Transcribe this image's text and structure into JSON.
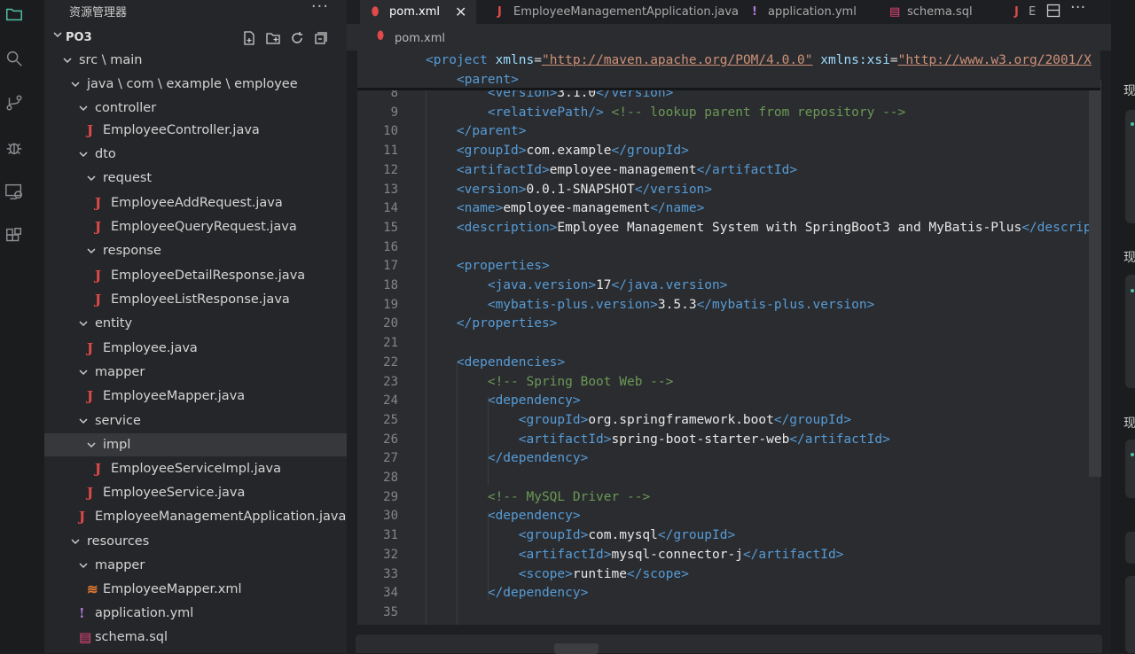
{
  "sidebar": {
    "title": "资源管理器",
    "more": "···",
    "project": "PO3",
    "tree": [
      {
        "label": "src \\ main",
        "type": "folder"
      },
      {
        "label": "java \\ com \\ example \\ employee",
        "type": "folder"
      },
      {
        "label": "controller",
        "type": "folder"
      },
      {
        "label": "EmployeeController.java",
        "type": "java"
      },
      {
        "label": "dto",
        "type": "folder"
      },
      {
        "label": "request",
        "type": "folder"
      },
      {
        "label": "EmployeeAddRequest.java",
        "type": "java"
      },
      {
        "label": "EmployeeQueryRequest.java",
        "type": "java"
      },
      {
        "label": "response",
        "type": "folder"
      },
      {
        "label": "EmployeeDetailResponse.java",
        "type": "java"
      },
      {
        "label": "EmployeeListResponse.java",
        "type": "java"
      },
      {
        "label": "entity",
        "type": "folder"
      },
      {
        "label": "Employee.java",
        "type": "java"
      },
      {
        "label": "mapper",
        "type": "folder"
      },
      {
        "label": "EmployeeMapper.java",
        "type": "java"
      },
      {
        "label": "service",
        "type": "folder"
      },
      {
        "label": "impl",
        "type": "folder",
        "selected": true
      },
      {
        "label": "EmployeeServiceImpl.java",
        "type": "java"
      },
      {
        "label": "EmployeeService.java",
        "type": "java"
      },
      {
        "label": "EmployeeManagementApplication.java",
        "type": "java"
      },
      {
        "label": "resources",
        "type": "folder"
      },
      {
        "label": "mapper",
        "type": "folder"
      },
      {
        "label": "EmployeeMapper.xml",
        "type": "xml"
      },
      {
        "label": "application.yml",
        "type": "yml"
      },
      {
        "label": "schema.sql",
        "type": "sql"
      }
    ]
  },
  "tabs": [
    {
      "label": "pom.xml",
      "icon": "xml",
      "active": true
    },
    {
      "label": "EmployeeManagementApplication.java",
      "icon": "java"
    },
    {
      "label": "application.yml",
      "icon": "yml"
    },
    {
      "label": "schema.sql",
      "icon": "sql"
    },
    {
      "label": "E",
      "icon": "java"
    }
  ],
  "breadcrumb": {
    "file": "pom.xml"
  },
  "editor": {
    "sticky": {
      "tag": "project",
      "attr1": "xmlns",
      "val1": "http://maven.apache.org/POM/4.0.0",
      "attr2": "xmlns:xsi",
      "val2": "http://www.w3.org/2001/X"
    },
    "sticky2": "<parent>",
    "lines": [
      {
        "n": "8",
        "segs": [
          {
            "t": "        <version>",
            "c": "tg"
          },
          {
            "t": "3.1.0",
            "c": "tx"
          },
          {
            "t": "</version>",
            "c": "tg"
          }
        ]
      },
      {
        "n": "9",
        "segs": [
          {
            "t": "        <relativePath/>",
            "c": "tg"
          },
          {
            "t": " <!-- lookup parent from repository -->",
            "c": "cm"
          }
        ]
      },
      {
        "n": "10",
        "segs": [
          {
            "t": "    </parent>",
            "c": "tg"
          }
        ]
      },
      {
        "n": "11",
        "segs": [
          {
            "t": "    <groupId>",
            "c": "tg"
          },
          {
            "t": "com.example",
            "c": "tx"
          },
          {
            "t": "</groupId>",
            "c": "tg"
          }
        ]
      },
      {
        "n": "12",
        "segs": [
          {
            "t": "    <artifactId>",
            "c": "tg"
          },
          {
            "t": "employee-management",
            "c": "tx"
          },
          {
            "t": "</artifactId>",
            "c": "tg"
          }
        ]
      },
      {
        "n": "13",
        "segs": [
          {
            "t": "    <version>",
            "c": "tg"
          },
          {
            "t": "0.0.1-SNAPSHOT",
            "c": "tx"
          },
          {
            "t": "</version>",
            "c": "tg"
          }
        ]
      },
      {
        "n": "14",
        "segs": [
          {
            "t": "    <name>",
            "c": "tg"
          },
          {
            "t": "employee-management",
            "c": "tx"
          },
          {
            "t": "</name>",
            "c": "tg"
          }
        ]
      },
      {
        "n": "15",
        "segs": [
          {
            "t": "    <description>",
            "c": "tg"
          },
          {
            "t": "Employee Management System with SpringBoot3 and MyBatis-Plus",
            "c": "tx"
          },
          {
            "t": "</descript",
            "c": "tg"
          }
        ]
      },
      {
        "n": "16",
        "segs": []
      },
      {
        "n": "17",
        "segs": [
          {
            "t": "    <properties>",
            "c": "tg"
          }
        ]
      },
      {
        "n": "18",
        "segs": [
          {
            "t": "        <java.version>",
            "c": "tg"
          },
          {
            "t": "17",
            "c": "tx"
          },
          {
            "t": "</java.version>",
            "c": "tg"
          }
        ]
      },
      {
        "n": "19",
        "segs": [
          {
            "t": "        <mybatis-plus.version>",
            "c": "tg"
          },
          {
            "t": "3.5.3",
            "c": "tx"
          },
          {
            "t": "</mybatis-plus.version>",
            "c": "tg"
          }
        ]
      },
      {
        "n": "20",
        "segs": [
          {
            "t": "    </properties>",
            "c": "tg"
          }
        ]
      },
      {
        "n": "21",
        "segs": []
      },
      {
        "n": "22",
        "segs": [
          {
            "t": "    <dependencies>",
            "c": "tg"
          }
        ]
      },
      {
        "n": "23",
        "segs": [
          {
            "t": "        <!-- Spring Boot Web -->",
            "c": "cm"
          }
        ]
      },
      {
        "n": "24",
        "segs": [
          {
            "t": "        <dependency>",
            "c": "tg"
          }
        ]
      },
      {
        "n": "25",
        "segs": [
          {
            "t": "            <groupId>",
            "c": "tg"
          },
          {
            "t": "org.springframework.boot",
            "c": "tx"
          },
          {
            "t": "</groupId>",
            "c": "tg"
          }
        ]
      },
      {
        "n": "26",
        "segs": [
          {
            "t": "            <artifactId>",
            "c": "tg"
          },
          {
            "t": "spring-boot-starter-web",
            "c": "tx"
          },
          {
            "t": "</artifactId>",
            "c": "tg"
          }
        ]
      },
      {
        "n": "27",
        "segs": [
          {
            "t": "        </dependency>",
            "c": "tg"
          }
        ]
      },
      {
        "n": "28",
        "segs": []
      },
      {
        "n": "29",
        "segs": [
          {
            "t": "        <!-- MySQL Driver -->",
            "c": "cm"
          }
        ]
      },
      {
        "n": "30",
        "segs": [
          {
            "t": "        <dependency>",
            "c": "tg"
          }
        ]
      },
      {
        "n": "31",
        "segs": [
          {
            "t": "            <groupId>",
            "c": "tg"
          },
          {
            "t": "com.mysql",
            "c": "tx"
          },
          {
            "t": "</groupId>",
            "c": "tg"
          }
        ]
      },
      {
        "n": "32",
        "segs": [
          {
            "t": "            <artifactId>",
            "c": "tg"
          },
          {
            "t": "mysql-connector-j",
            "c": "tx"
          },
          {
            "t": "</artifactId>",
            "c": "tg"
          }
        ]
      },
      {
        "n": "33",
        "segs": [
          {
            "t": "            <scope>",
            "c": "tg"
          },
          {
            "t": "runtime",
            "c": "tx"
          },
          {
            "t": "</scope>",
            "c": "tg"
          }
        ]
      },
      {
        "n": "34",
        "segs": [
          {
            "t": "        </dependency>",
            "c": "tg"
          }
        ]
      },
      {
        "n": "35",
        "segs": []
      }
    ]
  },
  "right_panel": {
    "chars": [
      "现",
      "现",
      "现"
    ]
  },
  "colors": {
    "accent": "#4fc1a5",
    "java": "#e04a4a",
    "tag": "#569cd6",
    "comment": "#6a9955"
  }
}
